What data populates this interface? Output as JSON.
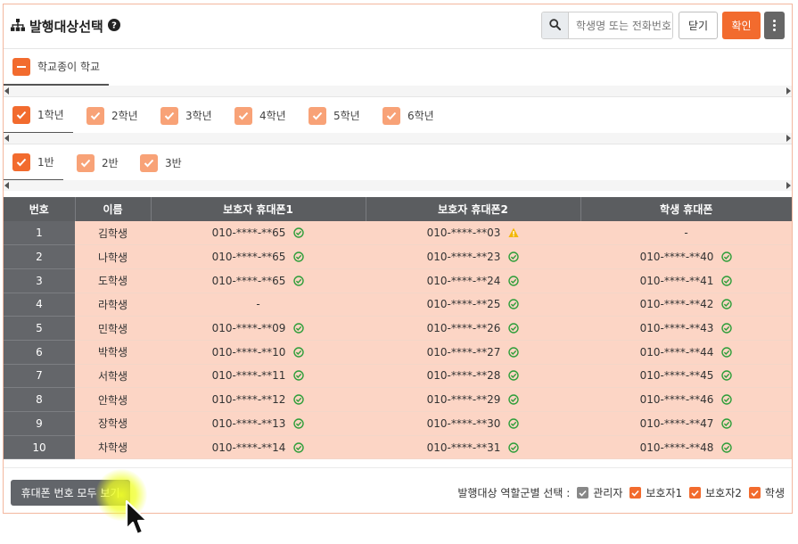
{
  "header": {
    "title": "발행대상선택",
    "title_icon": "sitemap-icon",
    "help_icon": "question-circle-icon",
    "search_placeholder": "학생명 또는 전화번호",
    "close_label": "닫기",
    "confirm_label": "확인"
  },
  "school_bar": {
    "items": [
      {
        "label": "학교종이 학교",
        "state": "indeterminate"
      }
    ]
  },
  "grade_bar": {
    "items": [
      {
        "label": "1학년",
        "checked": true,
        "active": true
      },
      {
        "label": "2학년",
        "checked": true
      },
      {
        "label": "3학년",
        "checked": true
      },
      {
        "label": "4학년",
        "checked": true
      },
      {
        "label": "5학년",
        "checked": true
      },
      {
        "label": "6학년",
        "checked": true
      }
    ]
  },
  "class_bar": {
    "items": [
      {
        "label": "1반",
        "checked": true,
        "active": true
      },
      {
        "label": "2반",
        "checked": true
      },
      {
        "label": "3반",
        "checked": true
      }
    ]
  },
  "table": {
    "headers": [
      "번호",
      "이름",
      "보호자 휴대폰1",
      "보호자 휴대폰2",
      "학생 휴대폰"
    ],
    "rows": [
      {
        "no": "1",
        "name": "김학생",
        "p1": "010-****-**65",
        "p1_status": "ok",
        "p2": "010-****-**03",
        "p2_status": "warning",
        "p3": "-",
        "p3_status": ""
      },
      {
        "no": "2",
        "name": "나학생",
        "p1": "010-****-**65",
        "p1_status": "ok",
        "p2": "010-****-**23",
        "p2_status": "ok",
        "p3": "010-****-**40",
        "p3_status": "ok"
      },
      {
        "no": "3",
        "name": "도학생",
        "p1": "010-****-**65",
        "p1_status": "ok",
        "p2": "010-****-**24",
        "p2_status": "ok",
        "p3": "010-****-**41",
        "p3_status": "ok"
      },
      {
        "no": "4",
        "name": "라학생",
        "p1": "-",
        "p1_status": "",
        "p2": "010-****-**25",
        "p2_status": "ok",
        "p3": "010-****-**42",
        "p3_status": "ok"
      },
      {
        "no": "5",
        "name": "민학생",
        "p1": "010-****-**09",
        "p1_status": "ok",
        "p2": "010-****-**26",
        "p2_status": "ok",
        "p3": "010-****-**43",
        "p3_status": "ok"
      },
      {
        "no": "6",
        "name": "박학생",
        "p1": "010-****-**10",
        "p1_status": "ok",
        "p2": "010-****-**27",
        "p2_status": "ok",
        "p3": "010-****-**44",
        "p3_status": "ok"
      },
      {
        "no": "7",
        "name": "서학생",
        "p1": "010-****-**11",
        "p1_status": "ok",
        "p2": "010-****-**28",
        "p2_status": "ok",
        "p3": "010-****-**45",
        "p3_status": "ok"
      },
      {
        "no": "8",
        "name": "안학생",
        "p1": "010-****-**12",
        "p1_status": "ok",
        "p2": "010-****-**29",
        "p2_status": "ok",
        "p3": "010-****-**46",
        "p3_status": "ok"
      },
      {
        "no": "9",
        "name": "장학생",
        "p1": "010-****-**13",
        "p1_status": "ok",
        "p2": "010-****-**30",
        "p2_status": "ok",
        "p3": "010-****-**47",
        "p3_status": "ok"
      },
      {
        "no": "10",
        "name": "차학생",
        "p1": "010-****-**14",
        "p1_status": "ok",
        "p2": "010-****-**31",
        "p2_status": "ok",
        "p3": "010-****-**48",
        "p3_status": "ok"
      }
    ]
  },
  "footer": {
    "show_all_label": "휴대폰 번호 모두 보기",
    "role_select_label": "발행대상 역할군별 선택 :",
    "roles": [
      {
        "label": "관리자",
        "checked": true,
        "color": "gray"
      },
      {
        "label": "보호자1",
        "checked": true,
        "color": "orange"
      },
      {
        "label": "보호자2",
        "checked": true,
        "color": "orange"
      },
      {
        "label": "학생",
        "checked": true,
        "color": "orange"
      }
    ]
  },
  "colors": {
    "accent": "#f26b2e",
    "row_bg": "#fcd5c5",
    "header_bg": "#5b5d60",
    "ok": "#2e9e3a",
    "warning": "#f2b705"
  }
}
